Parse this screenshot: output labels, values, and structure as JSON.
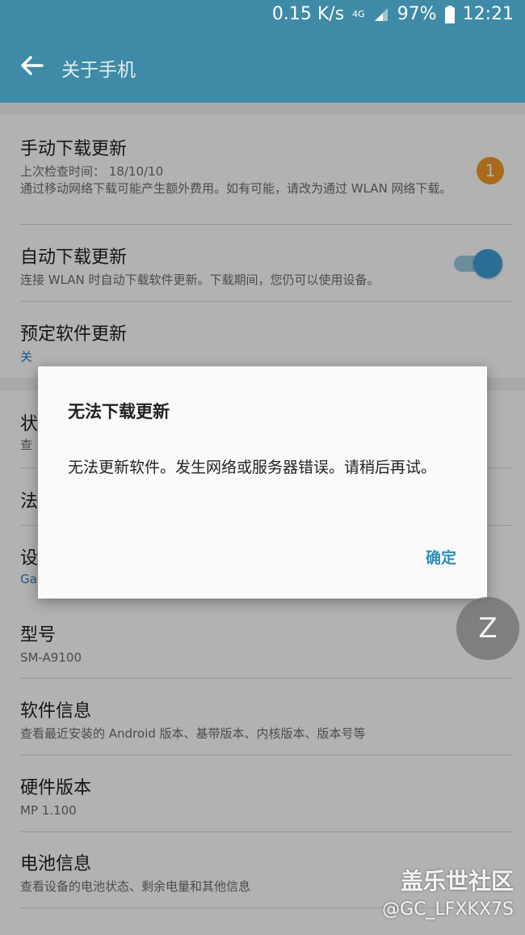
{
  "status_bar": {
    "speed": "0.15 K/s",
    "network": "4G",
    "battery": "97%",
    "time": "12:21"
  },
  "app_bar": {
    "title": "关于手机"
  },
  "items": [
    {
      "title": "手动下载更新",
      "subtitle": "上次检查时间： 18/10/10",
      "note": "通过移动网络下载可能产生额外费用。如有可能，请改为通过 WLAN 网络下载。",
      "badge": "1"
    },
    {
      "title": "自动下载更新",
      "subtitle": "连接 WLAN 时自动下载软件更新。下载期间，您仍可以使用设备。",
      "toggle_on": true
    },
    {
      "title": "预定软件更新",
      "subtitle": "关"
    },
    {
      "title": "状",
      "subtitle": "查"
    },
    {
      "title": "法"
    },
    {
      "title": "设",
      "subtitle": "Ga"
    },
    {
      "title": "型号",
      "subtitle": "SM-A9100"
    },
    {
      "title": "软件信息",
      "subtitle": "查看最近安装的 Android 版本、基带版本、内核版本、版本号等"
    },
    {
      "title": "硬件版本",
      "subtitle": "MP 1.100"
    },
    {
      "title": "电池信息",
      "subtitle": "查看设备的电池状态、剩余电量和其他信息"
    }
  ],
  "dialog": {
    "title": "无法下载更新",
    "message": "无法更新软件。发生网络或服务器错误。请稍后再试。",
    "confirm": "确定"
  },
  "fab": {
    "label": "Z"
  },
  "watermark": {
    "line1": "盖乐世社区",
    "line2": "@GC_LFXKX7S"
  },
  "colors": {
    "primary": "#3f8aa6",
    "accent": "#2f8fb6",
    "badge": "#f39a24",
    "toggle": "#3a9fd3"
  }
}
